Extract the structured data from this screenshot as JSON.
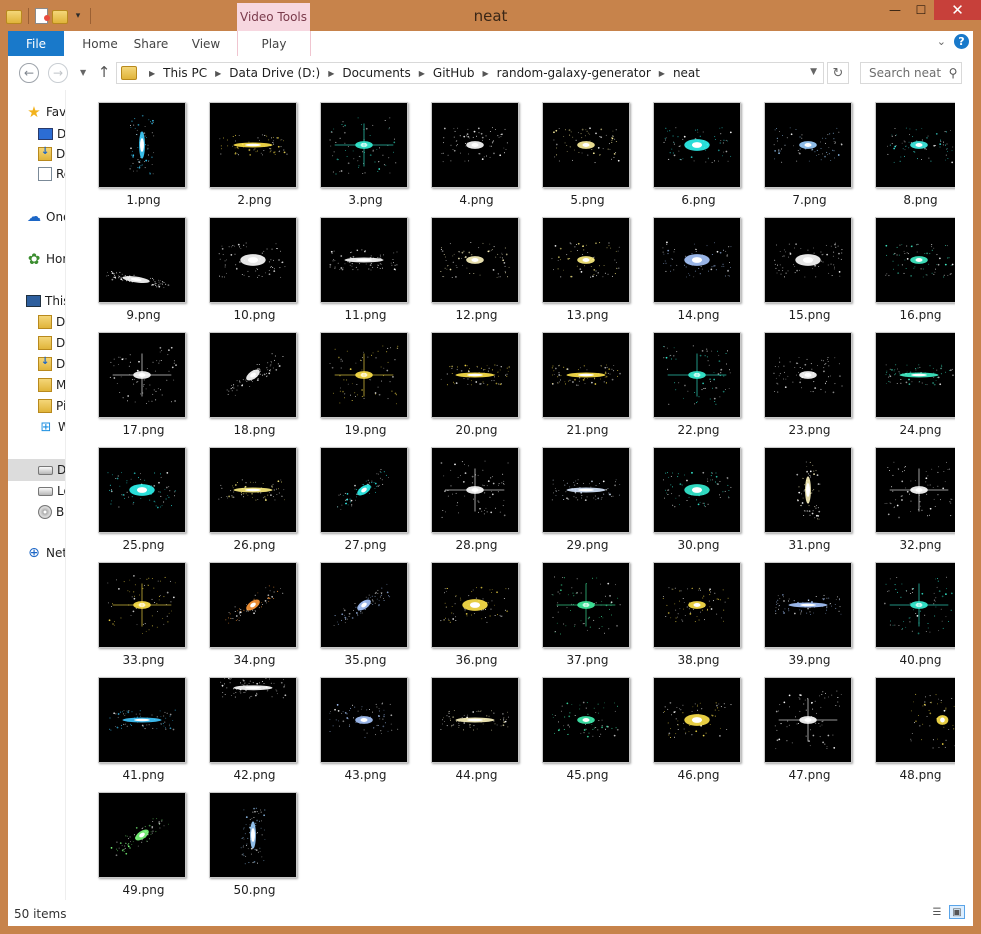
{
  "window": {
    "title": "neat",
    "contextual_tab": "Video Tools",
    "quick_access": [
      "folder-icon",
      "properties-icon",
      "new-folder-icon",
      "customize-quick-access-icon"
    ],
    "controls": {
      "minimize": "—",
      "maximize": "☐",
      "close": "✕"
    }
  },
  "ribbon": {
    "file_label": "File",
    "tabs": [
      "Home",
      "Share",
      "View",
      "Play"
    ],
    "expand_icon": "chevron-down-icon",
    "help_label": "?"
  },
  "navigation": {
    "back_icon": "back-arrow-icon",
    "forward_icon": "forward-arrow-icon",
    "recent_icon": "recent-locations-chevron-icon",
    "up_icon": "up-arrow-icon",
    "breadcrumb": [
      "This PC",
      "Data Drive (D:)",
      "Documents",
      "GitHub",
      "random-galaxy-generator",
      "neat"
    ],
    "search_placeholder": "Search neat"
  },
  "nav_pane": [
    {
      "label": "Favorites",
      "icon": "star-icon"
    },
    {
      "label": "Desktop",
      "icon": "desktop-icon"
    },
    {
      "label": "Downloads",
      "icon": "downloads-icon"
    },
    {
      "label": "Recent places",
      "icon": "recent-places-icon"
    },
    {
      "label": "OneDrive",
      "icon": "cloud-icon"
    },
    {
      "label": "Homegroup",
      "icon": "homegroup-icon"
    },
    {
      "label": "This PC",
      "icon": "computer-icon"
    },
    {
      "label": "Desktop",
      "icon": "desktop-folder-icon"
    },
    {
      "label": "Documents",
      "icon": "documents-folder-icon"
    },
    {
      "label": "Downloads",
      "icon": "downloads-folder-icon"
    },
    {
      "label": "Music",
      "icon": "music-folder-icon"
    },
    {
      "label": "Pictures",
      "icon": "pictures-folder-icon"
    },
    {
      "label": "Windows (C:)",
      "icon": "windows-drive-icon"
    },
    {
      "label": "Data Drive (D:)",
      "icon": "drive-icon",
      "selected": true
    },
    {
      "label": "Local Disk",
      "icon": "drive-icon"
    },
    {
      "label": "BD-ROM Drive",
      "icon": "disc-icon"
    },
    {
      "label": "Network",
      "icon": "network-icon"
    }
  ],
  "files": [
    {
      "name": "1.png",
      "color": "#3fd0ff",
      "shape": "v"
    },
    {
      "name": "2.png",
      "color": "#ffe34a",
      "shape": "h"
    },
    {
      "name": "3.png",
      "color": "#35f0d4",
      "shape": "x"
    },
    {
      "name": "4.png",
      "color": "#ffffff",
      "shape": "d"
    },
    {
      "name": "5.png",
      "color": "#fff2a0",
      "shape": "d"
    },
    {
      "name": "6.png",
      "color": "#2ff5f0",
      "shape": "b"
    },
    {
      "name": "7.png",
      "color": "#9ccfff",
      "shape": "d"
    },
    {
      "name": "8.png",
      "color": "#40f0e6",
      "shape": "d"
    },
    {
      "name": "9.png",
      "color": "#ffffff",
      "shape": "s"
    },
    {
      "name": "10.png",
      "color": "#ffffff",
      "shape": "b"
    },
    {
      "name": "11.png",
      "color": "#ffffff",
      "shape": "h"
    },
    {
      "name": "12.png",
      "color": "#fff6c0",
      "shape": "d"
    },
    {
      "name": "13.png",
      "color": "#fff080",
      "shape": "d"
    },
    {
      "name": "14.png",
      "color": "#a8c8ff",
      "shape": "b"
    },
    {
      "name": "15.png",
      "color": "#ffffff",
      "shape": "b"
    },
    {
      "name": "16.png",
      "color": "#40f0c8",
      "shape": "d"
    },
    {
      "name": "17.png",
      "color": "#ffffff",
      "shape": "x"
    },
    {
      "name": "18.png",
      "color": "#ffffff",
      "shape": "u"
    },
    {
      "name": "19.png",
      "color": "#ffe34a",
      "shape": "x"
    },
    {
      "name": "20.png",
      "color": "#ffe34a",
      "shape": "h"
    },
    {
      "name": "21.png",
      "color": "#ffe34a",
      "shape": "h"
    },
    {
      "name": "22.png",
      "color": "#35f0d4",
      "shape": "x"
    },
    {
      "name": "23.png",
      "color": "#ffffff",
      "shape": "d"
    },
    {
      "name": "24.png",
      "color": "#40f0c8",
      "shape": "h"
    },
    {
      "name": "25.png",
      "color": "#2ff5f0",
      "shape": "b"
    },
    {
      "name": "26.png",
      "color": "#fff080",
      "shape": "h"
    },
    {
      "name": "27.png",
      "color": "#2ff5f0",
      "shape": "u"
    },
    {
      "name": "28.png",
      "color": "#ffffff",
      "shape": "x"
    },
    {
      "name": "29.png",
      "color": "#d8e8ff",
      "shape": "h"
    },
    {
      "name": "30.png",
      "color": "#35f0d4",
      "shape": "b"
    },
    {
      "name": "31.png",
      "color": "#fff6c0",
      "shape": "v"
    },
    {
      "name": "32.png",
      "color": "#ffffff",
      "shape": "x"
    },
    {
      "name": "33.png",
      "color": "#ffe34a",
      "shape": "x"
    },
    {
      "name": "34.png",
      "color": "#ff9a3a",
      "shape": "u"
    },
    {
      "name": "35.png",
      "color": "#a8c8ff",
      "shape": "u"
    },
    {
      "name": "36.png",
      "color": "#ffe34a",
      "shape": "b"
    },
    {
      "name": "37.png",
      "color": "#40f0a0",
      "shape": "x"
    },
    {
      "name": "38.png",
      "color": "#ffe34a",
      "shape": "d"
    },
    {
      "name": "39.png",
      "color": "#a8c8ff",
      "shape": "h"
    },
    {
      "name": "40.png",
      "color": "#35f0d4",
      "shape": "x"
    },
    {
      "name": "41.png",
      "color": "#3fc8ff",
      "shape": "h"
    },
    {
      "name": "42.png",
      "color": "#ffffff",
      "shape": "t"
    },
    {
      "name": "43.png",
      "color": "#a8c8ff",
      "shape": "d"
    },
    {
      "name": "44.png",
      "color": "#fff6c0",
      "shape": "h"
    },
    {
      "name": "45.png",
      "color": "#40f0b0",
      "shape": "d"
    },
    {
      "name": "46.png",
      "color": "#ffe34a",
      "shape": "b"
    },
    {
      "name": "47.png",
      "color": "#ffffff",
      "shape": "x"
    },
    {
      "name": "48.png",
      "color": "#ffe34a",
      "shape": "r"
    },
    {
      "name": "49.png",
      "color": "#7dff7d",
      "shape": "u"
    },
    {
      "name": "50.png",
      "color": "#9ccfff",
      "shape": "v"
    }
  ],
  "status": {
    "item_count": "50 items",
    "details_view_icon": "details-view-icon",
    "large_icons_view_icon": "large-icons-view-icon"
  }
}
